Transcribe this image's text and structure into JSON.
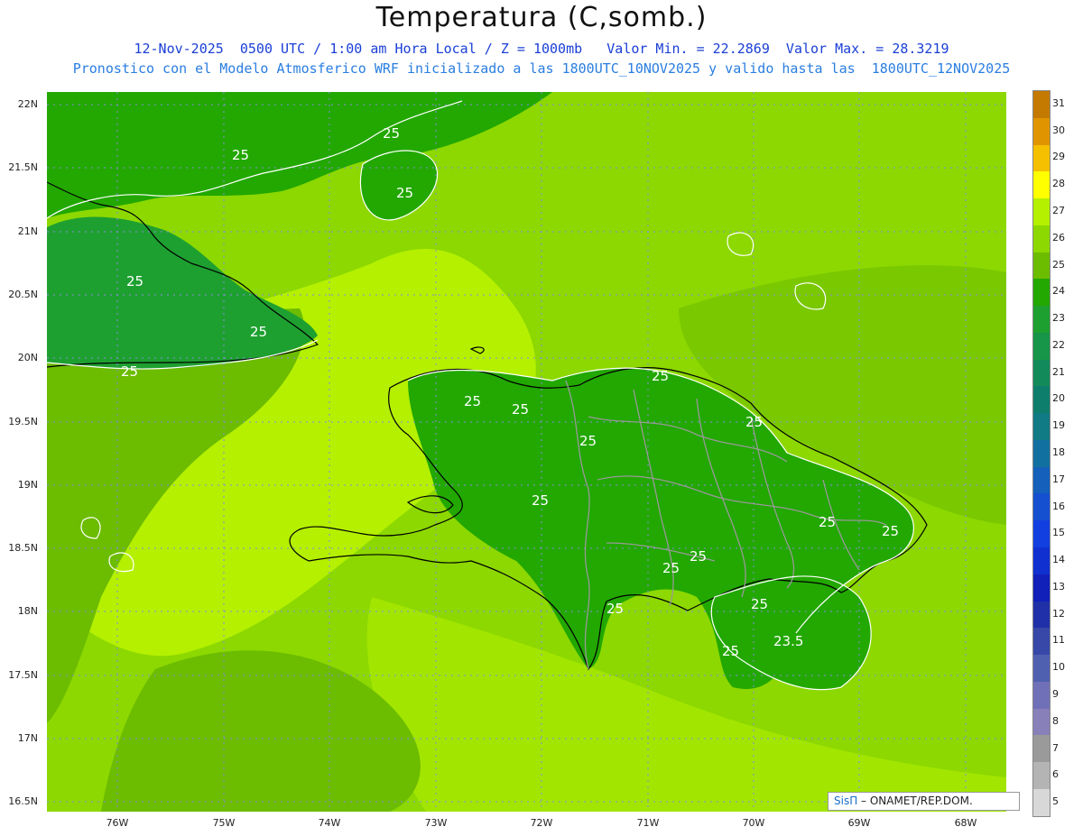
{
  "header": {
    "title": "Temperatura (C,somb.)",
    "line1": "12-Nov-2025  0500 UTC / 1:00 am Hora Local / Z = 1000mb   Valor Min. = 22.2869  Valor Max. = 28.3219",
    "line2": "Pronostico con el Modelo Atmosferico WRF inicializado a las 1800UTC_10NOV2025 y valido hasta las  1800UTC_12NOV2025"
  },
  "axes": {
    "lat_labels": [
      "22N",
      "21.5N",
      "21N",
      "20.5N",
      "20N",
      "19.5N",
      "19N",
      "18.5N",
      "18N",
      "17.5N",
      "17N",
      "16.5N"
    ],
    "lon_labels": [
      "76W",
      "75W",
      "74W",
      "73W",
      "72W",
      "71W",
      "70W",
      "69W",
      "68W"
    ]
  },
  "legend": {
    "levels": [
      "31",
      "30",
      "29",
      "28",
      "27",
      "26",
      "25",
      "24",
      "23",
      "22",
      "21",
      "20",
      "19",
      "18",
      "17",
      "16",
      "15",
      "14",
      "13",
      "12",
      "11",
      "10",
      "9",
      "8",
      "7",
      "6",
      "5"
    ],
    "colors": [
      "#c47a00",
      "#e09500",
      "#f5c000",
      "#ffff00",
      "#b4f000",
      "#8cd800",
      "#6cbc00",
      "#22a800",
      "#1ea030",
      "#179548",
      "#128a5a",
      "#0e7e6c",
      "#107a85",
      "#1270a0",
      "#1460bb",
      "#1450d0",
      "#1240e0",
      "#1030d0",
      "#1020b8",
      "#2030a8",
      "#3848a8",
      "#5060b0",
      "#7070b8",
      "#8880b8",
      "#9a9a9a",
      "#b4b4b4",
      "#d8d8d8"
    ]
  },
  "contour_labels": [
    "25",
    "25",
    "25",
    "25",
    "25",
    "25",
    "25",
    "25",
    "25",
    "25",
    "25",
    "25",
    "25",
    "25",
    "25",
    "25",
    "25",
    "25",
    "23.5",
    "25"
  ],
  "credit": {
    "brand": "SisΠ",
    "text": " – ONAMET/REP.DOM."
  }
}
